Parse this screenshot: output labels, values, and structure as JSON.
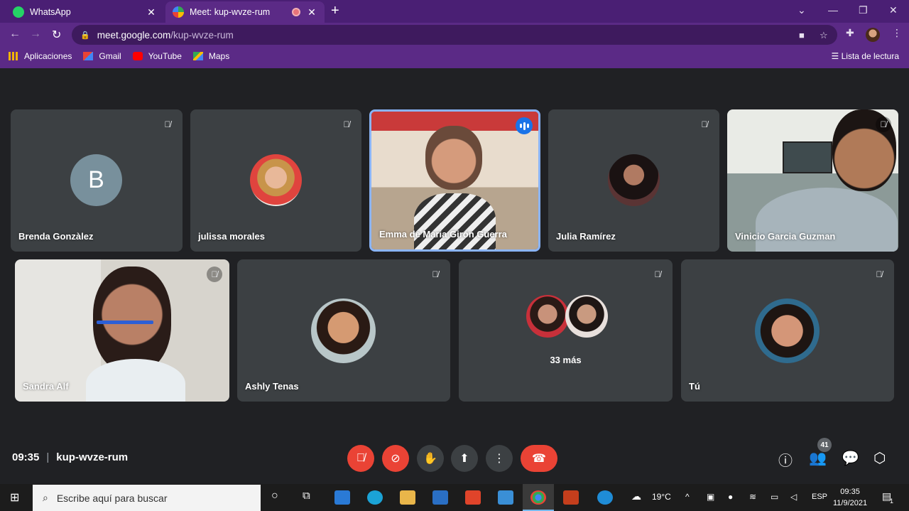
{
  "browser": {
    "tabs": [
      {
        "title": "WhatsApp",
        "active": false,
        "icon": "whatsapp-icon"
      },
      {
        "title": "Meet: kup-wvze-rum",
        "active": true,
        "icon": "meet-icon"
      }
    ],
    "url_domain": "meet.google.com",
    "url_path": "/kup-wvze-rum",
    "bookmarks": [
      {
        "label": "Aplicaciones",
        "icon": "apps-grid-icon"
      },
      {
        "label": "Gmail",
        "icon": "gmail-icon"
      },
      {
        "label": "YouTube",
        "icon": "youtube-icon"
      },
      {
        "label": "Maps",
        "icon": "maps-icon"
      }
    ],
    "reading_list": "Lista de lectura"
  },
  "participants": [
    {
      "name": "Brenda Gonzàlez",
      "avatar_letter": "B",
      "muted": true
    },
    {
      "name": "julissa morales",
      "muted": true
    },
    {
      "name": "Emma de Maria Girón Guerra",
      "speaking": true
    },
    {
      "name": "Julia Ramírez",
      "muted": true
    },
    {
      "name": "Vinicio Garcia Guzman",
      "muted": true
    },
    {
      "name": "Sandra Alf",
      "muted": true
    },
    {
      "name": "Ashly Tenas",
      "muted": true
    },
    {
      "name": "",
      "more_label": "33 más",
      "muted": true
    },
    {
      "name": "Tú",
      "muted": true
    }
  ],
  "meeting": {
    "time": "09:35",
    "code": "kup-wvze-rum",
    "participant_count": "41"
  },
  "controls": {
    "mic": "mic-off-icon",
    "camera": "camera-off-icon",
    "hand": "raise-hand-icon",
    "present": "present-icon",
    "more": "more-vert-icon",
    "end_call": "end-call-icon"
  },
  "colors": {
    "browser_frame": "#5b2a86",
    "meet_bg": "#202124",
    "tile_bg": "#3c4043",
    "danger": "#ea4335",
    "speaking_border": "#8ab4f8"
  },
  "taskbar": {
    "search_placeholder": "Escribe aquí para buscar",
    "temperature": "19°C",
    "language": "ESP",
    "time": "09:35",
    "date": "11/9/2021",
    "notifications": "1"
  }
}
